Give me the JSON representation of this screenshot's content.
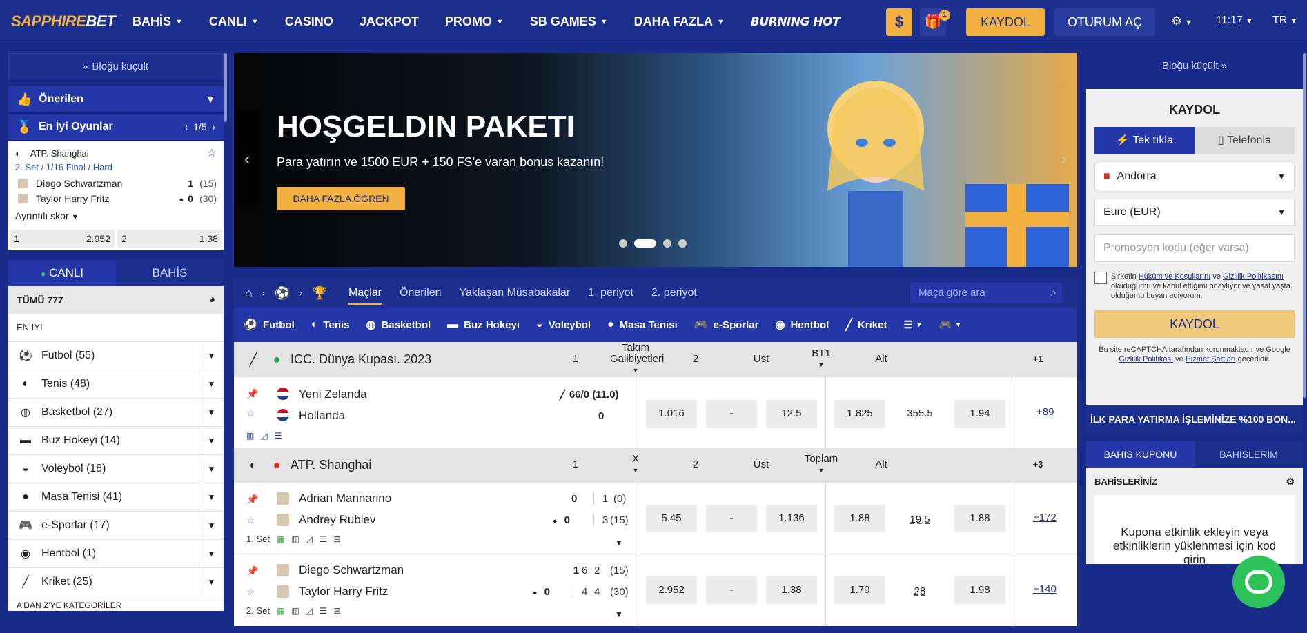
{
  "logo": {
    "part1": "SAPPHIRE",
    "part2": "BET"
  },
  "nav": [
    {
      "label": "BAHİS",
      "chev": true
    },
    {
      "label": "CANLI",
      "chev": true
    },
    {
      "label": "CASINO",
      "chev": false
    },
    {
      "label": "JACKPOT",
      "chev": false
    },
    {
      "label": "PROMO",
      "chev": true
    },
    {
      "label": "SB GAMES",
      "chev": true
    },
    {
      "label": "DAHA FAZLA",
      "chev": true
    }
  ],
  "nav_burning": "BURNING HOT",
  "topbar": {
    "currency_icon": "$",
    "gift_badge": "1",
    "register": "KAYDOL",
    "login": "OTURUM AÇ",
    "time": "11:17",
    "lang": "TR"
  },
  "left": {
    "collapse": "« Bloğu küçült",
    "recommended": "Önerilen",
    "best_games": "En İyi Oyunlar",
    "pager": "1/5",
    "card": {
      "league": "ATP. Shanghai",
      "stage": "2. Set / 1/16 Final / Hard",
      "p1": {
        "name": "Diego Schwartzman",
        "score": "1",
        "sub": "(15)"
      },
      "p2": {
        "name": "Taylor Harry Fritz",
        "score": "0",
        "sub": "(30)"
      },
      "detail": "Ayrıntılı skor",
      "o1k": "1",
      "o1v": "2.952",
      "o2k": "2",
      "o2v": "1.38"
    },
    "live": "CANLI",
    "bet": "BAHİS",
    "total": "TÜMÜ 777",
    "best": "EN İYİ",
    "sports": [
      {
        "name": "Futbol (55)",
        "icon": "⚽"
      },
      {
        "name": "Tenis (48)",
        "icon": "◐"
      },
      {
        "name": "Basketbol (27)",
        "icon": "◍"
      },
      {
        "name": "Buz Hokeyi (14)",
        "icon": "▬"
      },
      {
        "name": "Voleybol (18)",
        "icon": "◒"
      },
      {
        "name": "Masa Tenisi (41)",
        "icon": "●"
      },
      {
        "name": "e-Sporlar (17)",
        "icon": "🎮"
      },
      {
        "name": "Hentbol (1)",
        "icon": "◉"
      },
      {
        "name": "Kriket (25)",
        "icon": "╱"
      }
    ],
    "footer": "A'DAN Z'YE KATEGORİLER"
  },
  "banner": {
    "title": "HOŞGELDIN PAKETI",
    "subtitle": "Para yatırın ve 1500 EUR + 150 FS'e varan bonus kazanın!",
    "cta": "DAHA FAZLA ÖĞREN"
  },
  "center": {
    "tabs": [
      "Maçlar",
      "Önerilen",
      "Yaklaşan Müsabakalar",
      "1. periyot",
      "2. periyot"
    ],
    "search": "Maça göre ara",
    "sports": [
      "Futbol",
      "Tenis",
      "Basketbol",
      "Buz Hokeyi",
      "Voleybol",
      "Masa Tenisi",
      "e-Sporlar",
      "Hentbol",
      "Kriket"
    ],
    "group1": {
      "name": "ICC. Dünya Kupası. 2023",
      "h1": "1",
      "h2a": "Takım",
      "h2b": "Galibiyetleri",
      "h3": "2",
      "h4": "Üst",
      "h5": "BT1",
      "h6": "Alt",
      "more": "+1"
    },
    "m1": {
      "t1": "Yeni Zelanda",
      "t2": "Hollanda",
      "s1": "66/0 (11.0)",
      "s2": "0",
      "o1": "1.016",
      "o2": "-",
      "o3": "12.5",
      "o4": "1.825",
      "o5": "355.5",
      "o6": "1.94",
      "more": "+89"
    },
    "group2": {
      "name": "ATP. Shanghai",
      "h1": "1",
      "h2": "X",
      "h3": "2",
      "h4": "Üst",
      "h5": "Toplam",
      "h6": "Alt",
      "more": "+3"
    },
    "m2": {
      "t1": "Adrian Mannarino",
      "t2": "Andrey Rublev",
      "s1": "0",
      "s2": "0",
      "a1": "1",
      "a2": "3",
      "b1": "(0)",
      "b2": "(15)",
      "set": "1. Set",
      "o1": "5.45",
      "o2": "-",
      "o3": "1.136",
      "o4": "1.88",
      "o5": "19.5",
      "o6": "1.88",
      "more": "+172"
    },
    "m3": {
      "t1": "Diego Schwartzman",
      "t2": "Taylor Harry Fritz",
      "s1": "1",
      "s2": "0",
      "a1": "6",
      "a2": "4",
      "c1": "2",
      "c2": "4",
      "b1": "(15)",
      "b2": "(30)",
      "set": "2. Set",
      "o1": "2.952",
      "o2": "-",
      "o3": "1.38",
      "o4": "1.79",
      "o5": "28",
      "o6": "1.98",
      "more": "+140"
    }
  },
  "right": {
    "collapse": "Bloğu küçült »",
    "title": "KAYDOL",
    "tab1": "Tek tıkla",
    "tab2": "Telefonla",
    "country": "Andorra",
    "currency": "Euro (EUR)",
    "promo": "Promosyon kodu (eğer varsa)",
    "terms_a": "Şirketin ",
    "terms_link1": "Hüküm ve Koşullarını",
    "terms_b": " ve ",
    "terms_link2": "Gizlilik Politikasını",
    "terms_c": " okuduğumu ve kabul ettiğimi onaylıyor ve yasal yaşta olduğumu beyan ediyorum.",
    "button": "KAYDOL",
    "recap_a": "Bu site reCAPTCHA tarafından korunmaktadır ve Google ",
    "recap_link1": "Gizlilik Politikası",
    "recap_b": " ve ",
    "recap_link2": "Hizmet Şartları",
    "recap_c": " geçerlidir.",
    "promo_banner": "İLK PARA YATIRMA İŞLEMİNİZE %100 BON...",
    "coupon_tab": "BAHİS KUPONU",
    "mybets_tab": "BAHİSLERİM",
    "bets_label": "BAHİSLERİNİZ",
    "empty": "Kupona etkinlik ekleyin veya etkinliklerin yüklenmesi için kod girin"
  },
  "colors": {
    "navy": "#1c2f8e",
    "blue": "#2437a8",
    "gold": "#f1b040",
    "chat": "#2ec25a"
  }
}
